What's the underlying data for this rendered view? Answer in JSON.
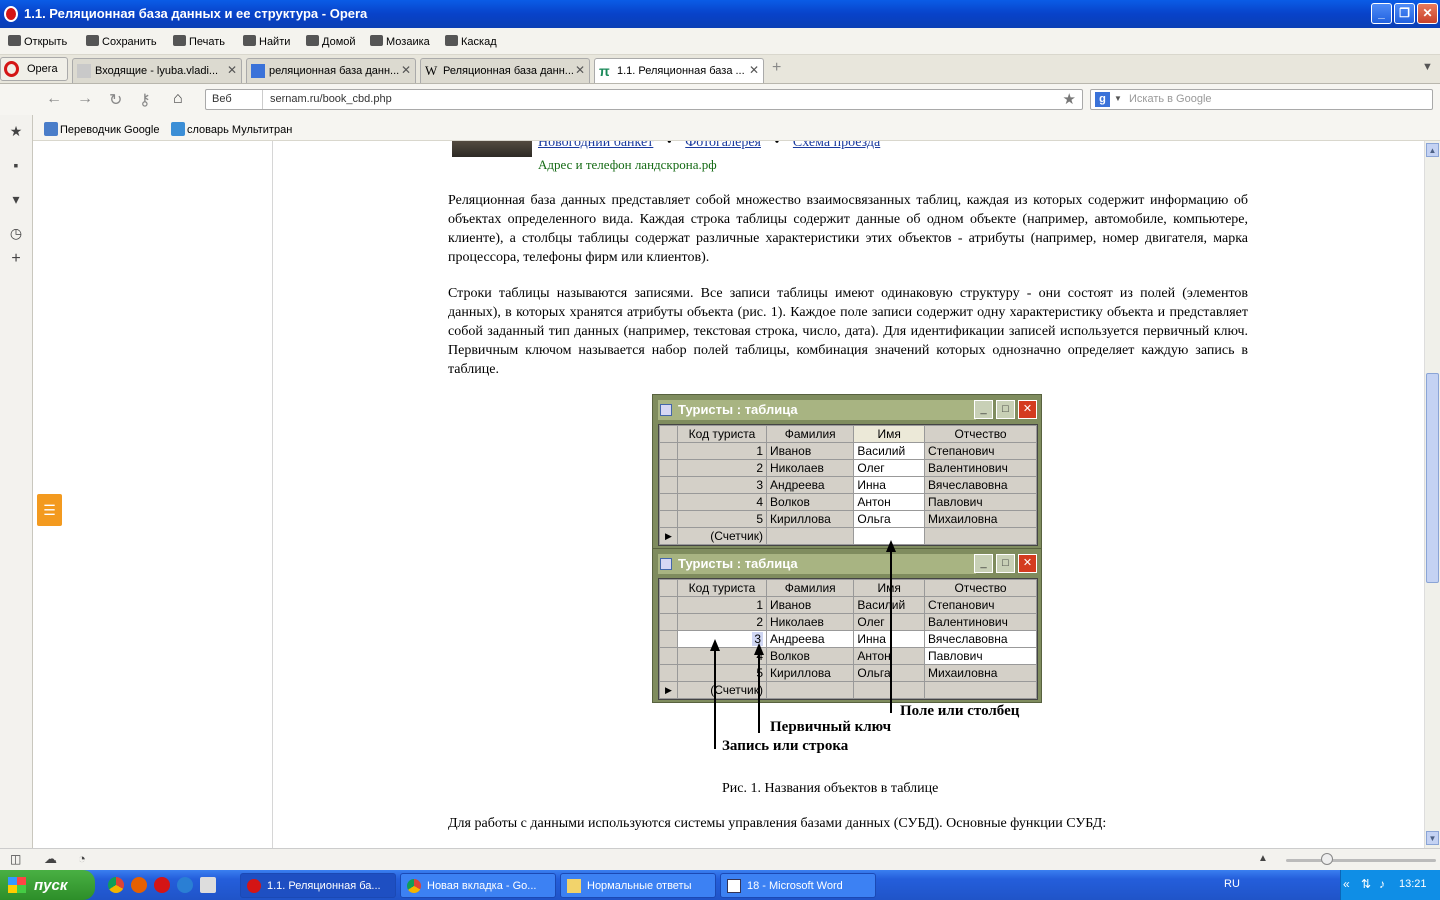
{
  "window": {
    "title": "1.1. Реляционная база данных и ее структура - Opera",
    "min": "_",
    "max": "❐",
    "close": "✕"
  },
  "menu": {
    "items": [
      "Открыть",
      "Сохранить",
      "Печать",
      "Найти",
      "Домой",
      "Мозаика",
      "Каскад"
    ]
  },
  "tabs": {
    "opera_label": "Opera",
    "items": [
      {
        "label": "Входящие - lyuba.vladi...",
        "close": "✕",
        "icon": "mail-icon"
      },
      {
        "label": "реляционная база данн...",
        "close": "✕",
        "icon": "google-icon"
      },
      {
        "label": "Реляционная база данн...",
        "close": "✕",
        "icon": "wikipedia-icon"
      },
      {
        "label": "1.1. Реляционная база ...",
        "close": "✕",
        "icon": "pi-icon"
      }
    ],
    "new_tab": "+"
  },
  "address": {
    "mode": "Веб",
    "url": "sernam.ru/book_cbd.php",
    "search_placeholder": "Искать в Google",
    "search_engine": "g"
  },
  "bookmarks": {
    "items": [
      "Переводчик Google",
      "словарь Мультитран"
    ]
  },
  "page": {
    "top_links": [
      "Новогодний банкет",
      "Фотогалерея",
      "Схема проезда"
    ],
    "link_sep": "•",
    "address_line": "Адрес и телефон  ландскрона.рф",
    "para1": "Реляционная база данных представляет собой множество взаимосвязанных таблиц, каждая из которых содержит информацию об объектах определенного вида. Каждая строка таблицы содержит данные об одном объекте (например, автомобиле, компьютере, клиенте), а столбцы таблицы содержат различные характеристики этих объектов - атрибуты (например, номер двигателя, марка процессора, телефоны фирм или клиентов).",
    "para2": "Строки таблицы называются записями. Все записи таблицы имеют одинаковую структуру - они состоят из полей (элементов данных), в которых хранятся атрибуты объекта (рис. 1). Каждое поле записи содержит одну характеристику объекта и представляет собой заданный тип данных (например, текстовая строка, число, дата). Для идентификации записей используется первичный ключ. Первичным ключом называется набор полей таблицы, комбинация значений которых однозначно определяет каждую запись в таблице.",
    "caption": "Рис. 1. Названия объектов в таблице",
    "para3": "Для работы с данными используются системы управления базами данных (СУБД). Основные функции СУБД:"
  },
  "figure": {
    "window_title": "Туристы : таблица",
    "columns": [
      "Код туриста",
      "Фамилия",
      "Имя",
      "Отчество"
    ],
    "rows": [
      [
        "1",
        "Иванов",
        "Василий",
        "Степанович"
      ],
      [
        "2",
        "Николаев",
        "Олег",
        "Валентинович"
      ],
      [
        "3",
        "Андреева",
        "Инна",
        "Вячеславовна"
      ],
      [
        "4",
        "Волков",
        "Антон",
        "Павлович"
      ],
      [
        "5",
        "Кириллова",
        "Ольга",
        "Михаиловна"
      ]
    ],
    "counter": "(Счетчик)",
    "label_field": "Поле или столбец",
    "label_key": "Первичный ключ",
    "label_record": "Запись или строка"
  },
  "taskbar": {
    "start": "пуск",
    "tasks": [
      "1.1. Реляционная ба...",
      "Новая вкладка - Go...",
      "Нормальные ответы",
      "18 - Microsoft Word"
    ],
    "lang": "RU",
    "time": "13:21"
  }
}
